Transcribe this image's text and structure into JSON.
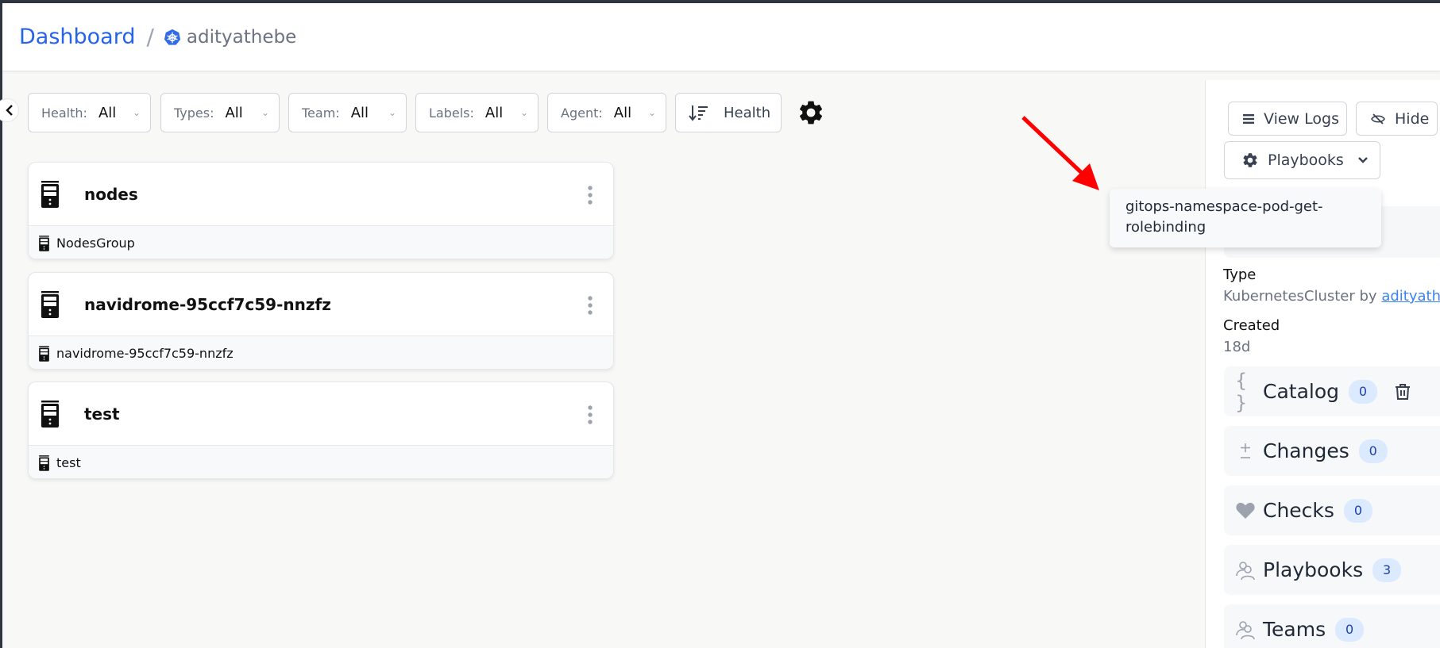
{
  "breadcrumb": {
    "root": "Dashboard",
    "separator": "/",
    "current_icon": "kubernetes-icon",
    "current": "adityathebe"
  },
  "filters": [
    {
      "label": "Health:",
      "value": "All"
    },
    {
      "label": "Types:",
      "value": "All"
    },
    {
      "label": "Team:",
      "value": "All"
    },
    {
      "label": "Labels:",
      "value": "All"
    },
    {
      "label": "Agent:",
      "value": "All"
    }
  ],
  "sort": {
    "label": "Health",
    "icon": "sort-descending-icon"
  },
  "cards": [
    {
      "title": "nodes",
      "subtitle": "NodesGroup",
      "icon": "server-icon"
    },
    {
      "title": "navidrome-95ccf7c59-nnzfz",
      "subtitle": "navidrome-95ccf7c59-nnzfz",
      "icon": "server-icon"
    },
    {
      "title": "test",
      "subtitle": "test",
      "icon": "server-icon"
    }
  ],
  "panel": {
    "view_logs_label": "View Logs",
    "hide_label": "Hide",
    "playbooks_label": "Playbooks",
    "playbooks_menu": [
      "gitops-namespace-pod-get-rolebinding"
    ],
    "type_label": "Type",
    "type_value": "KubernetesCluster by ",
    "type_owner": "adityathe",
    "created_label": "Created",
    "created_value": "18d",
    "sections": [
      {
        "title": "Catalog",
        "count": "0",
        "icon": "braces-icon"
      },
      {
        "title": "Changes",
        "count": "0",
        "icon": "plus-minus-icon"
      },
      {
        "title": "Checks",
        "count": "0",
        "icon": "heart-icon"
      },
      {
        "title": "Playbooks",
        "count": "3",
        "icon": "users-icon"
      },
      {
        "title": "Teams",
        "count": "0",
        "icon": "users-icon"
      }
    ]
  },
  "colors": {
    "accent": "#2563eb",
    "annotation_arrow": "#ff0000",
    "badge_bg": "#dbeafe",
    "badge_text": "#1e40af"
  }
}
